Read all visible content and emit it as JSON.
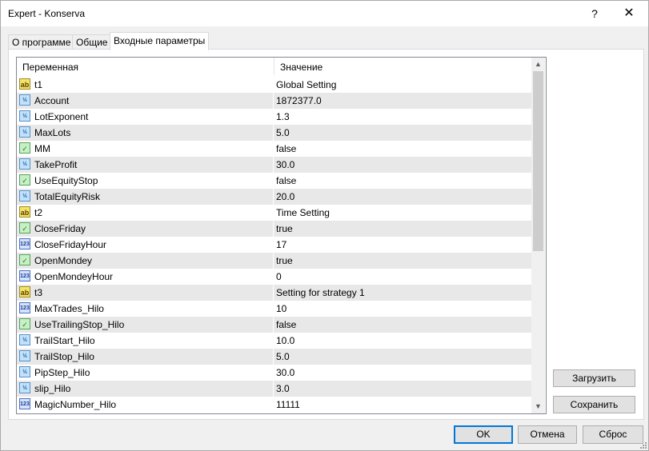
{
  "window": {
    "title": "Expert - Konserva",
    "help_glyph": "?",
    "close_glyph": "✕"
  },
  "tabs": [
    {
      "label": "О программе",
      "active": false
    },
    {
      "label": "Общие",
      "active": false
    },
    {
      "label": "Входные параметры",
      "active": true
    }
  ],
  "grid": {
    "columns": {
      "variable": "Переменная",
      "value": "Значение"
    },
    "rows": [
      {
        "type": "string",
        "icon": "ab",
        "name": "t1",
        "value": "Global Setting"
      },
      {
        "type": "double",
        "icon": "½",
        "name": "Account",
        "value": "1872377.0"
      },
      {
        "type": "double",
        "icon": "½",
        "name": "LotExponent",
        "value": "1.3"
      },
      {
        "type": "double",
        "icon": "½",
        "name": "MaxLots",
        "value": "5.0"
      },
      {
        "type": "bool",
        "icon": "✓",
        "name": "MM",
        "value": "false"
      },
      {
        "type": "double",
        "icon": "½",
        "name": "TakeProfit",
        "value": "30.0"
      },
      {
        "type": "bool",
        "icon": "✓",
        "name": "UseEquityStop",
        "value": "false"
      },
      {
        "type": "double",
        "icon": "½",
        "name": "TotalEquityRisk",
        "value": "20.0"
      },
      {
        "type": "string",
        "icon": "ab",
        "name": "t2",
        "value": "Time Setting"
      },
      {
        "type": "bool",
        "icon": "✓",
        "name": "CloseFriday",
        "value": "true"
      },
      {
        "type": "int",
        "icon": "123",
        "name": "CloseFridayHour",
        "value": "17"
      },
      {
        "type": "bool",
        "icon": "✓",
        "name": "OpenMondey",
        "value": "true"
      },
      {
        "type": "int",
        "icon": "123",
        "name": "OpenMondeyHour",
        "value": "0"
      },
      {
        "type": "string",
        "icon": "ab",
        "name": "t3",
        "value": "Setting for strategy 1"
      },
      {
        "type": "int",
        "icon": "123",
        "name": "MaxTrades_Hilo",
        "value": "10"
      },
      {
        "type": "bool",
        "icon": "✓",
        "name": "UseTrailingStop_Hilo",
        "value": "false"
      },
      {
        "type": "double",
        "icon": "½",
        "name": "TrailStart_Hilo",
        "value": "10.0"
      },
      {
        "type": "double",
        "icon": "½",
        "name": "TrailStop_Hilo",
        "value": "5.0"
      },
      {
        "type": "double",
        "icon": "½",
        "name": "PipStep_Hilo",
        "value": "30.0"
      },
      {
        "type": "double",
        "icon": "½",
        "name": "slip_Hilo",
        "value": "3.0"
      },
      {
        "type": "int",
        "icon": "123",
        "name": "MagicNumber_Hilo",
        "value": "11111"
      }
    ]
  },
  "side_buttons": {
    "load": "Загрузить",
    "save": "Сохранить"
  },
  "bottom_buttons": {
    "ok": "OK",
    "cancel": "Отмена",
    "reset": "Сброс"
  },
  "colors": {
    "accent": "#0078d7",
    "odd_row": "#e8e8e8"
  }
}
